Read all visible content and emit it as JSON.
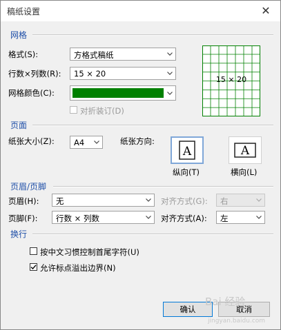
{
  "window": {
    "title": "稿纸设置",
    "close_glyph": "✕"
  },
  "grid_section": {
    "heading": "网格",
    "style_label": "格式(S):",
    "style_value": "方格式稿纸",
    "rowcol_label": "行数×列数(R):",
    "rowcol_value": "15 × 20",
    "color_label": "网格颜色(C):",
    "color_value": "#008000",
    "fold_label": "对折装订(D)",
    "fold_checked": false,
    "fold_enabled": false,
    "preview_text": "15 × 20"
  },
  "page_section": {
    "heading": "页面",
    "size_label": "纸张大小(Z):",
    "size_value": "A4",
    "orientation_label": "纸张方向:",
    "portrait_label": "纵向(T)",
    "landscape_label": "横向(L)",
    "orientation_glyph": "A",
    "selected_orientation": "portrait"
  },
  "header_footer_section": {
    "heading": "页眉/页脚",
    "header_label": "页眉(H):",
    "header_value": "无",
    "header_align_label": "对齐方式(G):",
    "header_align_value": "右",
    "header_align_enabled": false,
    "footer_label": "页脚(F):",
    "footer_value": "行数 × 列数",
    "footer_align_label": "对齐方式(A):",
    "footer_align_value": "左"
  },
  "wrap_section": {
    "heading": "换行",
    "option1_label": "按中文习惯控制首尾字符(U)",
    "option1_checked": false,
    "option2_label": "允许标点溢出边界(N)",
    "option2_checked": true
  },
  "buttons": {
    "ok_label": "确认",
    "cancel_label": "取消"
  },
  "watermark": {
    "text": "Bai 经验",
    "url_text": "jingyan.baidu.com"
  },
  "colors": {
    "section_heading": "#1f4fa8",
    "grid_green": "#008000",
    "dialog_bg": "#f0f0f0"
  }
}
